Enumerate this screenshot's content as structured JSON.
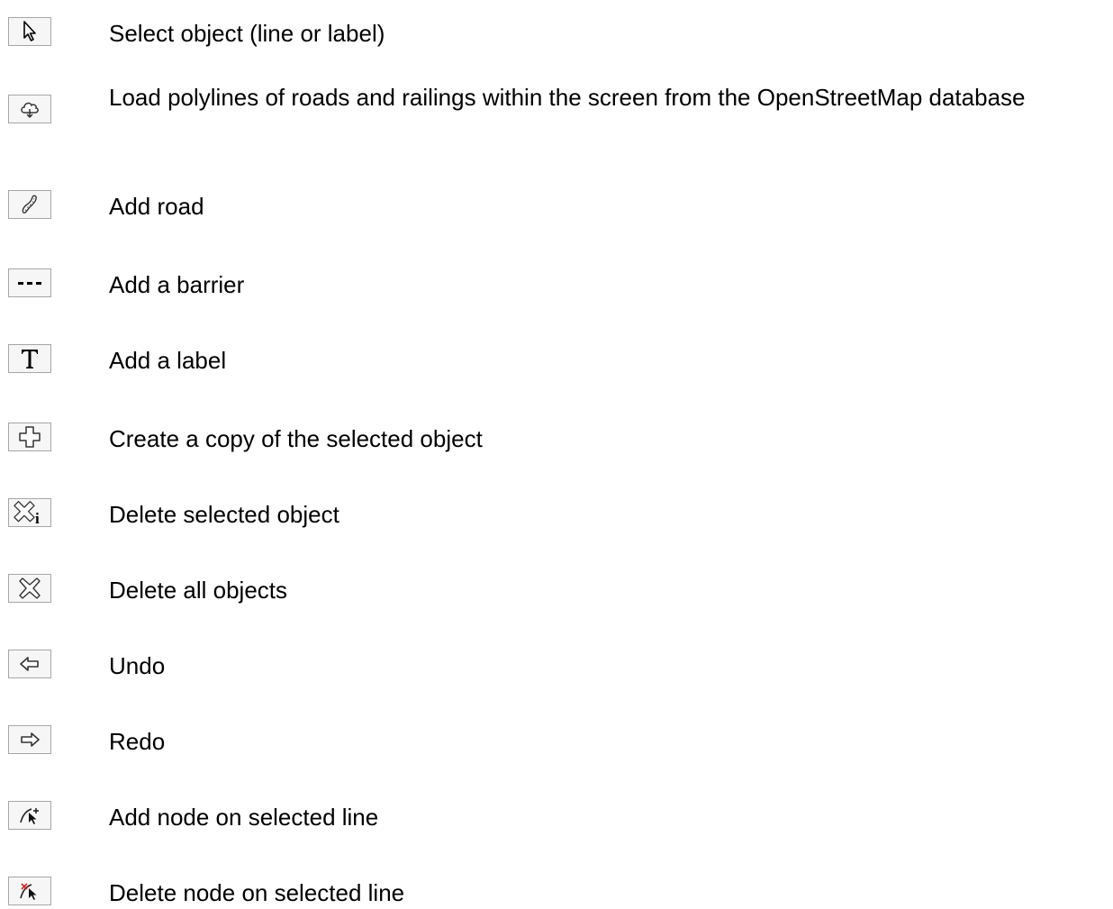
{
  "tools": [
    {
      "icon": "select-arrow-icon",
      "description": "Select object (line or label)"
    },
    {
      "icon": "cloud-download-icon",
      "description": "Load polylines of roads and railings within the screen from the OpenStreetMap database"
    },
    {
      "icon": "road-icon",
      "description": "Add road"
    },
    {
      "icon": "barrier-icon",
      "description": "Add a barrier"
    },
    {
      "icon": "text-icon",
      "description": "Add a label"
    },
    {
      "icon": "copy-plus-icon",
      "description": "Create a copy of the selected object"
    },
    {
      "icon": "delete-selected-icon",
      "description": "Delete selected object"
    },
    {
      "icon": "delete-all-icon",
      "description": "Delete all objects"
    },
    {
      "icon": "undo-arrow-icon",
      "description": "Undo"
    },
    {
      "icon": "redo-arrow-icon",
      "description": "Redo"
    },
    {
      "icon": "add-node-icon",
      "description": "Add node on selected line"
    },
    {
      "icon": "delete-node-icon",
      "description": "Delete node on selected line"
    }
  ],
  "colors": {
    "button_border": "#a6a6a6",
    "button_fill": "#f6f6f6",
    "delete_node_accent": "#e02020"
  }
}
